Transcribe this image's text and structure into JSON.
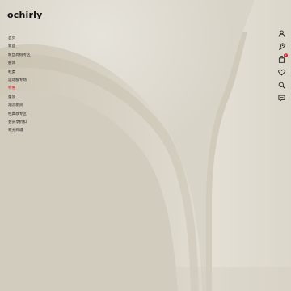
{
  "brand": {
    "logo_text": "ochirly"
  },
  "nav": {
    "items": [
      {
        "label": "首页",
        "sale": false
      },
      {
        "label": "新品",
        "sale": false
      },
      {
        "label": "粉丝尚购专区",
        "sale": false
      },
      {
        "label": "服饰",
        "sale": false
      },
      {
        "label": "鞋类",
        "sale": false
      },
      {
        "label": "运动服专场",
        "sale": false
      },
      {
        "label": "特惠",
        "sale": true
      },
      {
        "label": "童装",
        "sale": false
      },
      {
        "label": "潮流新货",
        "sale": false
      },
      {
        "label": "经典款专区",
        "sale": false
      },
      {
        "label": "会员享折扣",
        "sale": false
      },
      {
        "label": "积分商城",
        "sale": false
      }
    ]
  },
  "side_icons": [
    {
      "name": "user-icon"
    },
    {
      "name": "location-pin-icon"
    },
    {
      "name": "shopping-bag-icon",
      "badge": "2"
    },
    {
      "name": "heart-icon"
    },
    {
      "name": "search-icon"
    },
    {
      "name": "chat-icon"
    }
  ],
  "colors": {
    "sale": "#d3222a",
    "text": "#222222",
    "badge": "#d3222a"
  }
}
